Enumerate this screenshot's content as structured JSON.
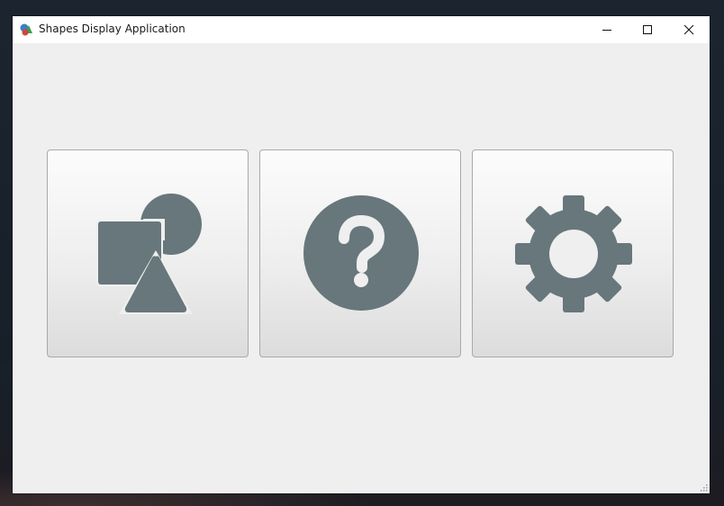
{
  "window": {
    "title": "Shapes Display Application",
    "app_icon": "shapes-app-icon",
    "controls": {
      "minimize_icon": "minimize-icon",
      "maximize_icon": "maximize-icon",
      "close_icon": "close-icon"
    }
  },
  "tiles": [
    {
      "name": "shapes",
      "icon": "shapes-icon"
    },
    {
      "name": "help",
      "icon": "question-mark-icon"
    },
    {
      "name": "settings",
      "icon": "gear-icon"
    }
  ],
  "colors": {
    "icon_fill": "#67777c",
    "window_background": "#efefef",
    "titlebar_background": "#ffffff",
    "tile_border": "#a9a9a9"
  }
}
